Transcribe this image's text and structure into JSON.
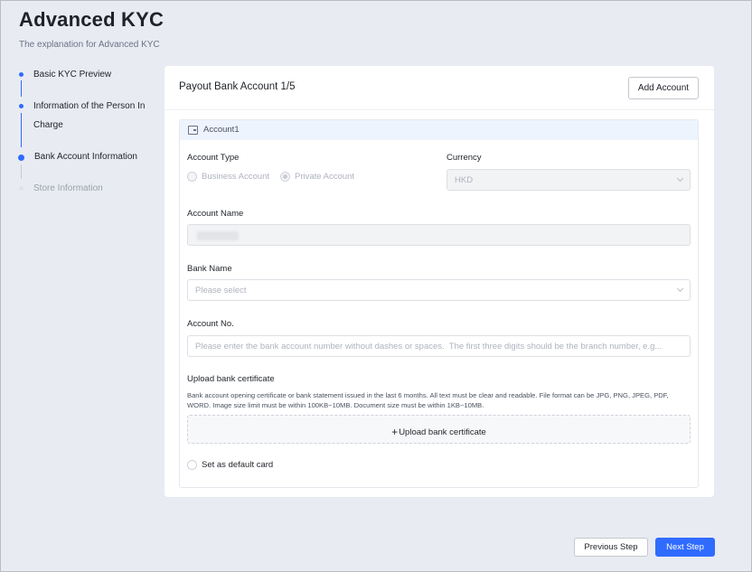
{
  "header": {
    "title": "Advanced KYC",
    "subtitle": "The explanation for Advanced KYC"
  },
  "steps": [
    {
      "label": "Basic KYC Preview",
      "state": "done"
    },
    {
      "label": "Information of the Person In Charge",
      "state": "done"
    },
    {
      "label": "Bank Account Information",
      "state": "current"
    },
    {
      "label": "Store Information",
      "state": "pending"
    }
  ],
  "card": {
    "title": "Payout Bank Account 1/5",
    "add_button": "Add Account"
  },
  "account": {
    "name": "Account1",
    "account_type": {
      "label": "Account Type",
      "options": [
        "Business Account",
        "Private Account"
      ],
      "selected": "Private Account"
    },
    "currency": {
      "label": "Currency",
      "value": "HKD"
    },
    "account_name": {
      "label": "Account Name"
    },
    "bank_name": {
      "label": "Bank Name",
      "placeholder": "Please select"
    },
    "account_no": {
      "label": "Account No.",
      "placeholder": "Please enter the bank account number without dashes or spaces.  The first three digits should be the branch number, e.g..."
    },
    "upload": {
      "label": "Upload bank certificate",
      "description": "Bank account opening certificate or bank statement issued in the last 6 months. All text must be clear and readable. File format can be JPG, PNG, JPEG, PDF, WORD. Image size limit must be within 100KB~10MB. Document size must be within 1KB~10MB.",
      "button": "Upload bank certificate"
    },
    "default_card": {
      "label": "Set as default card",
      "checked": false
    }
  },
  "footer": {
    "prev": "Previous Step",
    "next": "Next Step"
  },
  "colors": {
    "accent": "#2f6bff",
    "background": "#e8ebf2"
  }
}
